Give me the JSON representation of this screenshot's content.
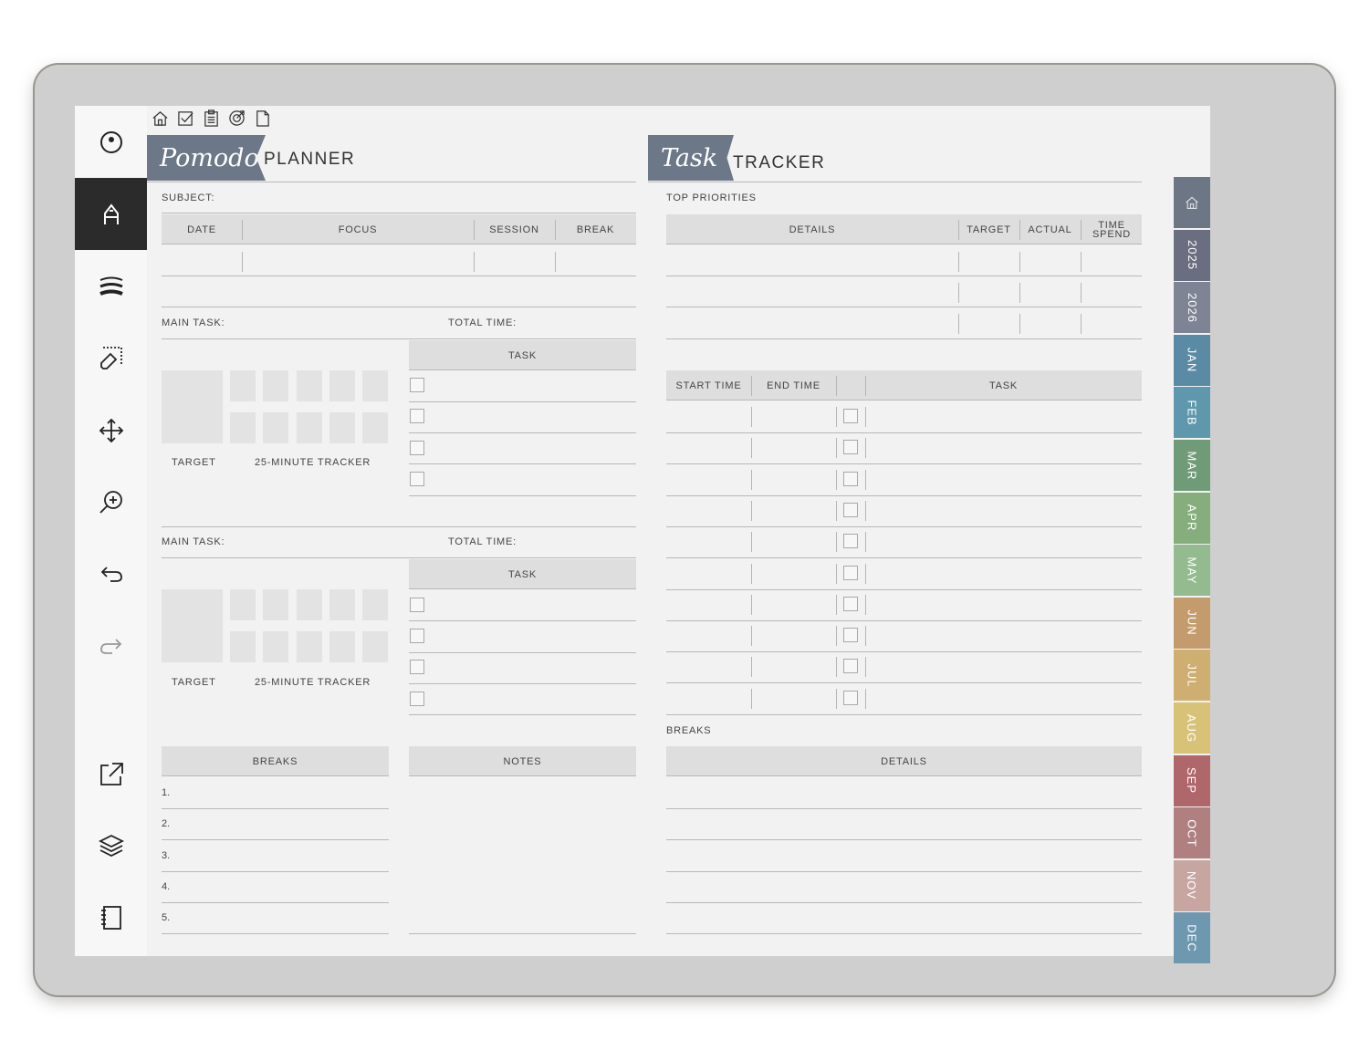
{
  "pomodoro": {
    "script_title": "Pomodoro",
    "title": "PLANNER",
    "subject_label": "SUBJECT:",
    "columns": [
      "DATE",
      "FOCUS",
      "SESSION",
      "BREAK"
    ],
    "main_task_label": "MAIN TASK:",
    "total_time_label": "TOTAL TIME:",
    "task_header": "TASK",
    "target_label": "TARGET",
    "tracker_label": "25-MINUTE TRACKER",
    "breaks_header": "BREAKS",
    "notes_header": "NOTES",
    "break_numbers": [
      "1.",
      "2.",
      "3.",
      "4.",
      "5."
    ]
  },
  "tracker": {
    "script_title": "Task",
    "title": "TRACKER",
    "priorities_label": "TOP PRIORITIES",
    "priority_columns": [
      "DETAILS",
      "TARGET",
      "ACTUAL",
      "TIME SPEND"
    ],
    "time_columns": [
      "START TIME",
      "END TIME",
      "TASK"
    ],
    "breaks_label": "BREAKS",
    "details_header": "DETAILS"
  },
  "side_tabs": [
    {
      "label": "",
      "icon": "home-icon",
      "color": "#6d7685"
    },
    {
      "label": "2025",
      "color": "#6b6e80"
    },
    {
      "label": "2026",
      "color": "#7f8494"
    },
    {
      "label": "JAN",
      "color": "#5a8aa4"
    },
    {
      "label": "FEB",
      "color": "#5f97ad"
    },
    {
      "label": "MAR",
      "color": "#6f9b78"
    },
    {
      "label": "APR",
      "color": "#86ad7c"
    },
    {
      "label": "MAY",
      "color": "#93bb8f"
    },
    {
      "label": "JUN",
      "color": "#c49b6c"
    },
    {
      "label": "JUL",
      "color": "#cfae72"
    },
    {
      "label": "AUG",
      "color": "#d8c278"
    },
    {
      "label": "SEP",
      "color": "#b0676b"
    },
    {
      "label": "OCT",
      "color": "#b08080"
    },
    {
      "label": "NOV",
      "color": "#c7a6a1"
    },
    {
      "label": "DEC",
      "color": "#6e97b0"
    }
  ],
  "toolbar_icons": [
    "circle-menu-icon",
    "pen-icon",
    "stroke-width-icon",
    "eraser-icon",
    "move-icon",
    "zoom-icon",
    "undo-icon",
    "redo-icon",
    "export-icon",
    "layers-icon",
    "notebook-icon"
  ],
  "top_nav_icons": [
    "home-icon",
    "checkbox-icon",
    "clipboard-icon",
    "target-icon",
    "page-icon"
  ]
}
